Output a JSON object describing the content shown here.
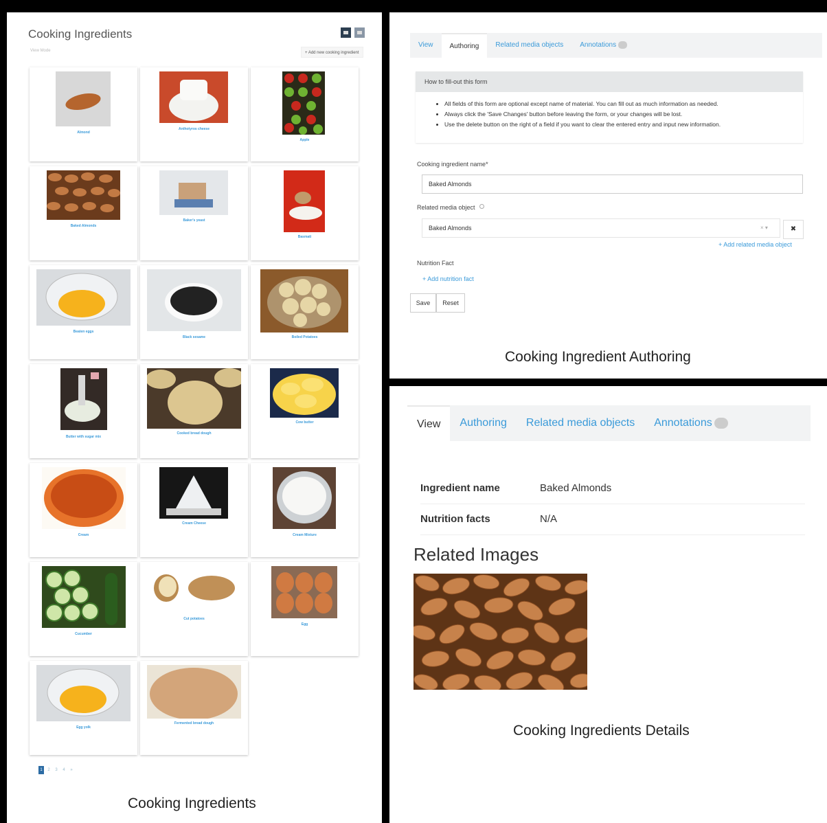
{
  "list_view": {
    "title": "Cooking Ingredients",
    "subtitle": "View Mode",
    "add_button": "+ Add new cooking ingredient",
    "view_toggle": [
      "grid-view-icon",
      "list-view-icon"
    ],
    "items": [
      {
        "name": "Almond"
      },
      {
        "name": "Anthotyros cheese"
      },
      {
        "name": "Apple"
      },
      {
        "name": "Baked Almonds"
      },
      {
        "name": "Baker's yeast"
      },
      {
        "name": "Basmati"
      },
      {
        "name": "Beaten eggs"
      },
      {
        "name": "Black sesame"
      },
      {
        "name": "Boiled Potatoes"
      },
      {
        "name": "Butter with sugar mix"
      },
      {
        "name": "Cooked bread dough"
      },
      {
        "name": "Cow butter"
      },
      {
        "name": "Cream"
      },
      {
        "name": "Cream Cheese"
      },
      {
        "name": "Cream Mixture"
      },
      {
        "name": "Cucumber"
      },
      {
        "name": "Cut potatoes"
      },
      {
        "name": "Egg"
      },
      {
        "name": "Egg yolk"
      },
      {
        "name": "Fermented bread dough"
      }
    ],
    "pagination": [
      "1",
      "2",
      "3",
      "4",
      "»"
    ],
    "caption": "Cooking Ingredients"
  },
  "authoring": {
    "tabs": [
      "View",
      "Authoring",
      "Related media objects",
      "Annotations"
    ],
    "active_tab": "Authoring",
    "help_title": "How to fill-out this form",
    "help_items": [
      "All fields of this form are optional except name of material. You can fill out as much information as needed.",
      "Always click the 'Save Changes' button before leaving the form, or your changes will be lost.",
      "Use the delete button on the right of a field if you want to clear the entered entry and input new information."
    ],
    "name_label": "Cooking ingredient name*",
    "name_value": "Baked Almonds",
    "media_label": "Related media object",
    "media_value": "Baked Almonds",
    "add_media_link": "+ Add related media object",
    "nutrition_label": "Nutrition Fact",
    "add_nutrition_link": "+ Add nutrition fact",
    "save_label": "Save",
    "reset_label": "Reset",
    "clear_symbol": "✖",
    "select_controls": "× ▾",
    "caption": "Cooking Ingredient Authoring"
  },
  "details": {
    "tabs": [
      "View",
      "Authoring",
      "Related media objects",
      "Annotations"
    ],
    "active_tab": "View",
    "fields": [
      {
        "key": "Ingredient name",
        "value": "Baked Almonds"
      },
      {
        "key": "Nutrition facts",
        "value": "N/A"
      }
    ],
    "related_title": "Related Images",
    "caption": "Cooking Ingredients Details"
  },
  "colors": {
    "link": "#3a9ad9",
    "dark_toggle": "#2c3e50",
    "almond": "#b5652e",
    "tab_bar": "#f2f3f4"
  }
}
